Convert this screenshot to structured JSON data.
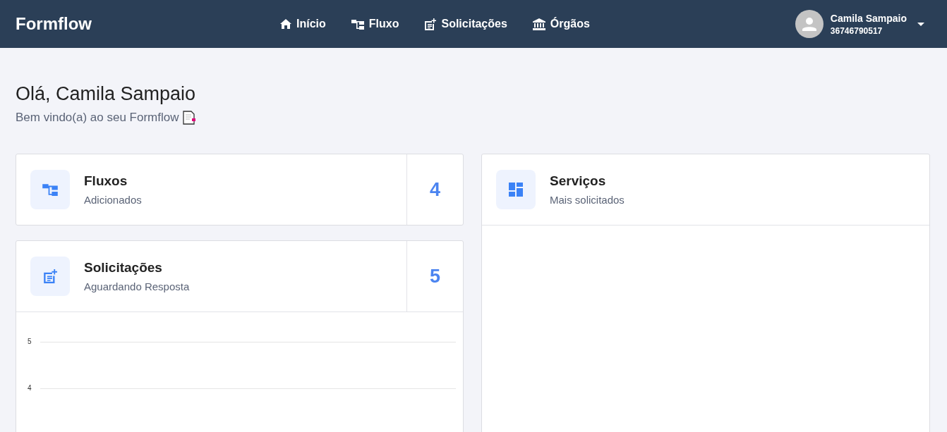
{
  "header": {
    "brand": "Formflow",
    "nav": [
      {
        "label": "Início",
        "kind": "home"
      },
      {
        "label": "Fluxo",
        "kind": "flow"
      },
      {
        "label": "Solicitações",
        "kind": "request"
      },
      {
        "label": "Órgãos",
        "kind": "bank"
      }
    ],
    "user": {
      "name": "Camila Sampaio",
      "id": "36746790517"
    }
  },
  "greeting": {
    "title": "Olá, Camila Sampaio",
    "subtitle": "Bem vindo(a) ao seu Formflow"
  },
  "stats": [
    {
      "title": "Fluxos",
      "subtitle": "Adicionados",
      "count": "4",
      "kind": "flow"
    },
    {
      "title": "Solicitações",
      "subtitle": "Aguardando Resposta",
      "count": "5",
      "kind": "request"
    }
  ],
  "chart": {
    "tick_labels": [
      "5",
      "4"
    ]
  },
  "services": {
    "title": "Serviços",
    "subtitle": "Mais solicitados"
  }
}
